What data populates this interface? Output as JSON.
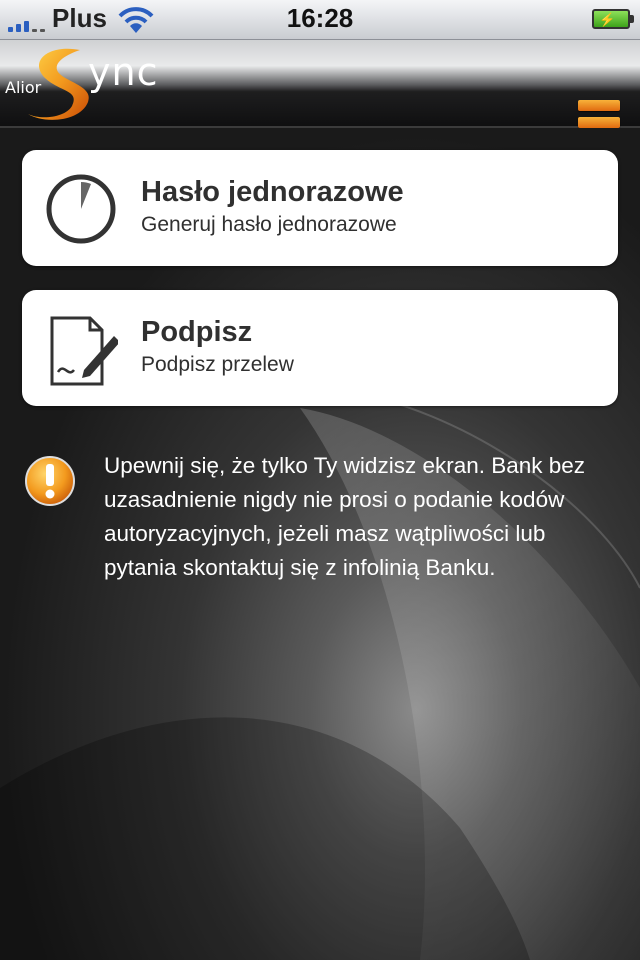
{
  "status_bar": {
    "carrier": "Plus",
    "time": "16:28"
  },
  "header": {
    "logo_alior": "Alior",
    "logo_sync": "ync",
    "brand_color": "#f39a1e"
  },
  "cards": [
    {
      "title": "Hasło jednorazowe",
      "subtitle": "Generuj hasło jednorazowe",
      "icon": "clock-icon"
    },
    {
      "title": "Podpisz",
      "subtitle": "Podpisz przelew",
      "icon": "sign-document-icon"
    }
  ],
  "warning": {
    "text": "Upewnij się, że tylko Ty widzisz ekran. Bank bez uzasadnienie nigdy nie prosi o podanie kodów autoryzacyjnych, jeżeli masz wątpliwości lub pytania skontaktuj się z infolinią Banku.",
    "icon": "warning-icon"
  }
}
